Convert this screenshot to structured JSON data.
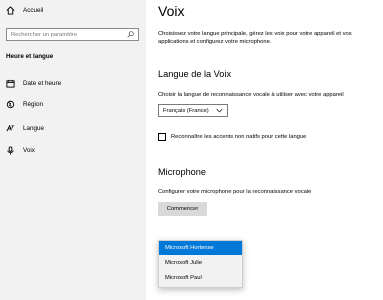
{
  "sidebar": {
    "home_label": "Accueil",
    "search_placeholder": "Rechercher un paramètre",
    "section_title": "Heure et langue",
    "items": [
      {
        "label": "Date et heure",
        "icon": "calendar-icon"
      },
      {
        "label": "Région",
        "icon": "region-icon"
      },
      {
        "label": "Langue",
        "icon": "language-icon"
      },
      {
        "label": "Voix",
        "icon": "microphone-icon"
      }
    ]
  },
  "main": {
    "title": "Voix",
    "intro": "Choisissez votre langue principale, gérez les voix pour votre appareil et vos applications et configurez votre microphone.",
    "voice_language": {
      "heading": "Langue de la Voix",
      "prompt": "Choisir la langue de reconnaissance vocale à utiliser avec votre appareil",
      "selected_value": "Français (France)",
      "checkbox_label": "Reconnaître les accents non natifs pour cette langue"
    },
    "microphone": {
      "heading": "Microphone",
      "prompt": "Configurer votre microphone pour la reconnaissance vocale",
      "button_label": "Commencer"
    }
  },
  "voice_dropdown": {
    "options": [
      "Microsoft Hortense",
      "Microsoft Julie",
      "Microsoft Paul"
    ],
    "selected_index": 0
  },
  "colors": {
    "accent": "#0078d7",
    "sidebar_bg": "#f2f2f2",
    "button_bg": "#d9d9d9"
  }
}
